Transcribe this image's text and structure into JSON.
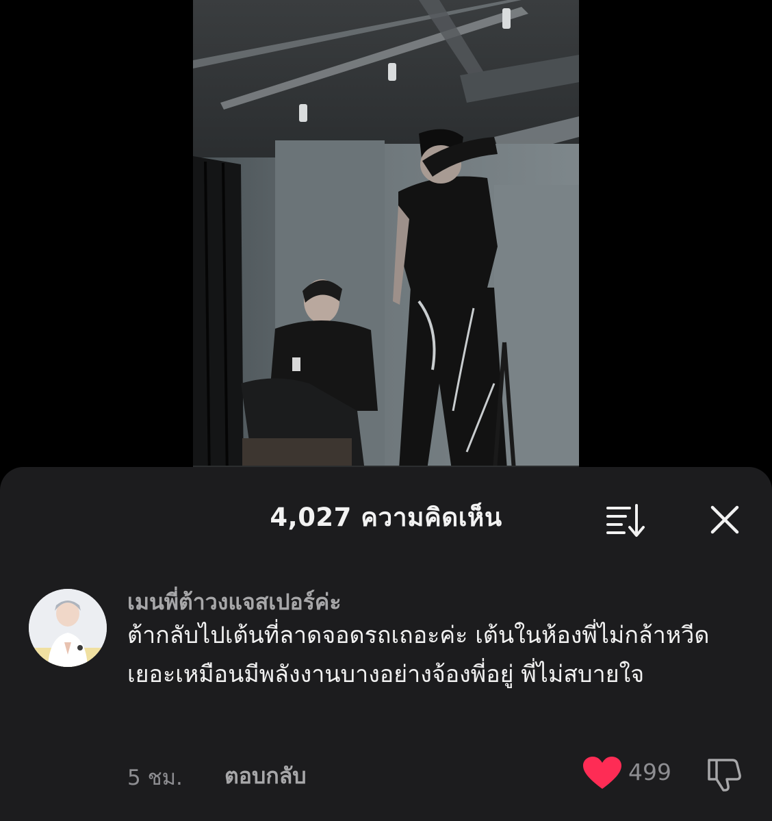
{
  "comments_sheet": {
    "count_label": "4,027 ความคิดเห็น",
    "sort_icon": "sort-icon",
    "close_icon": "close-icon"
  },
  "comment": {
    "username": "เมนพี่ต้าวงแจสเปอร์ค่ะ",
    "text": "ต้ากลับไปเต้นที่ลาดจอดรถเถอะค่ะ เต้นในห้องพี่ไม่กล้าหวีดเยอะเหมือนมีพลังงานบางอย่างจ้องพี่อยู่ พี่ไม่สบายใจ",
    "timestamp": "5 ชม.",
    "reply_label": "ตอบกลับ",
    "like_count": "499",
    "like_icon": "heart-icon",
    "dislike_icon": "thumbs-down-icon"
  },
  "colors": {
    "sheet_background": "#1c1c1e",
    "heart": "#fe2c55",
    "muted_text": "#8e8e92"
  }
}
